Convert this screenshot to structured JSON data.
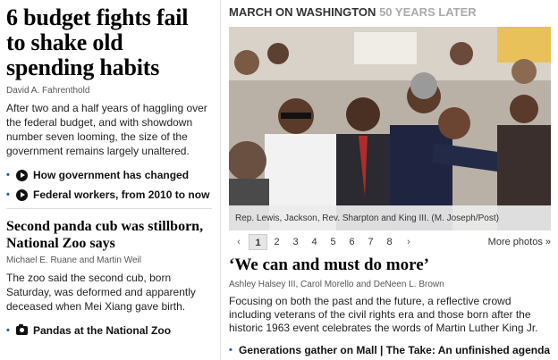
{
  "left": {
    "story1": {
      "headline": "6 budget fights fail to shake old spending habits",
      "byline": "David A. Fahrenthold",
      "blurb": "After two and a half years of haggling over the federal budget, and with showdown number seven looming, the size of the government remains largely unaltered.",
      "related": [
        {
          "label": "How government has changed",
          "icon": "play-icon"
        },
        {
          "label": "Federal workers, from 2010 to now",
          "icon": "play-icon"
        }
      ]
    },
    "story2": {
      "headline": "Second panda cub was stillborn, National Zoo says",
      "byline": "Michael E. Ruane and Martin Weil",
      "blurb": "The zoo said the second cub, born Saturday, was deformed and apparently deceased when Mei Xiang gave birth.",
      "related": [
        {
          "label": "Pandas at the National Zoo",
          "icon": "camera-icon"
        }
      ]
    }
  },
  "right": {
    "kicker": "MARCH ON WASHINGTON",
    "kicker_muted": "50 YEARS LATER",
    "photo_caption": "Rep. Lewis, Jackson, Rev. Sharpton and King III. (M. Joseph/Post)",
    "pager": {
      "prev": "‹",
      "next": "›",
      "pages": [
        "1",
        "2",
        "3",
        "4",
        "5",
        "6",
        "7",
        "8"
      ],
      "active_page": "1",
      "more": "More photos »"
    },
    "headline": "‘We can and must do more’",
    "byline": "Ashley Halsey III, Carol Morello and DeNeen L. Brown",
    "blurb": "Focusing on both the past and the future, a reflective crowd including veterans of the civil rights era and those born after the historic 1963 event celebrates the words of Martin Luther King Jr.",
    "related": "Generations gather on Mall | The Take: An unfinished agenda"
  },
  "colors": {
    "bullet": "#1a5fa8",
    "muted_kicker": "#aaaaaa"
  }
}
